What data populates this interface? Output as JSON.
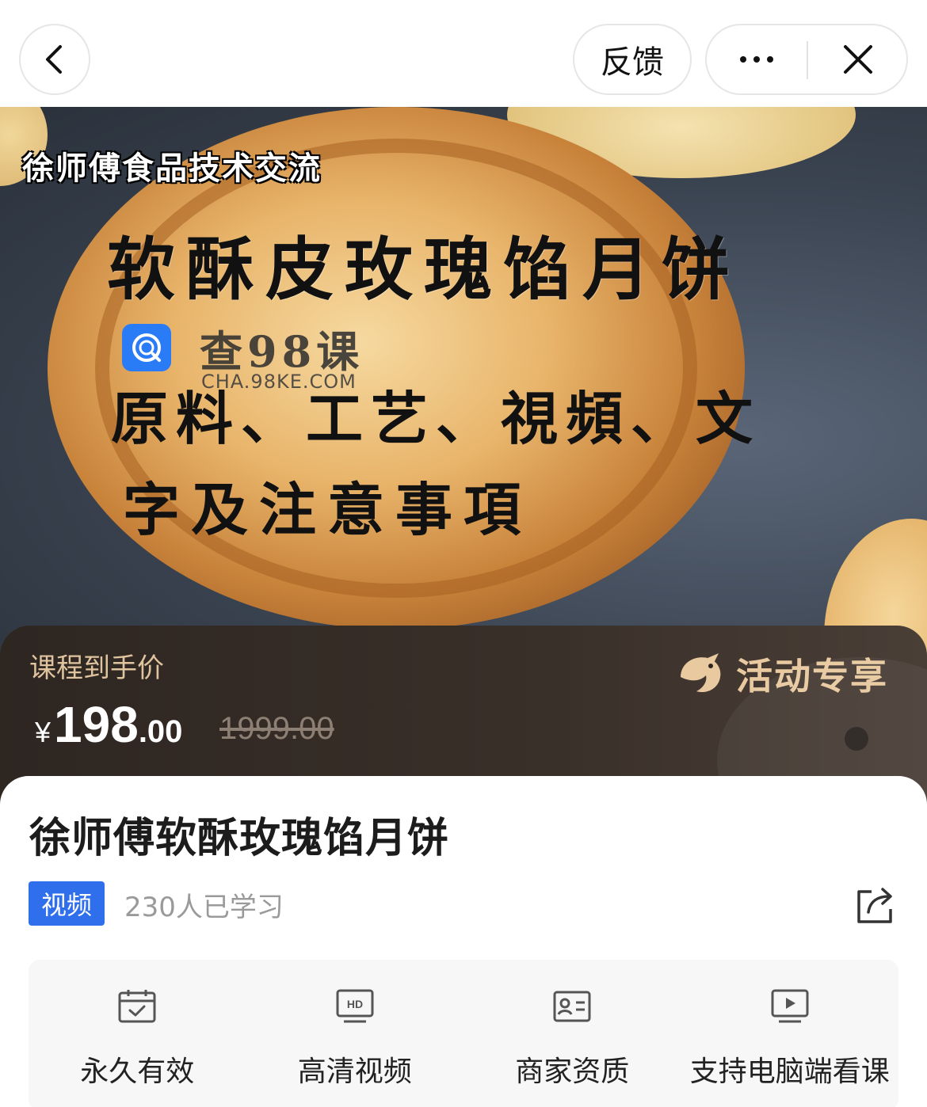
{
  "topbar": {
    "feedback_label": "反馈"
  },
  "hero": {
    "subtitle": "徐师傅食品技术交流",
    "headline": "软酥皮玫瑰馅月饼",
    "line2": "原料、工艺、視頻、文",
    "line3": "字及注意事項",
    "watermark_name": "查98课",
    "watermark_url": "CHA.98KE.COM"
  },
  "price": {
    "label": "课程到手价",
    "currency": "¥",
    "integer": "198",
    "decimal": ".00",
    "original": "1999.00",
    "promo_label": "活动专享"
  },
  "course": {
    "title": "徐师傅软酥玫瑰馅月饼",
    "tag": "视频",
    "learners": "230人已学习"
  },
  "features": [
    {
      "icon": "calendar-check-icon",
      "label": "永久有效"
    },
    {
      "icon": "hd-monitor-icon",
      "label": "高清视频"
    },
    {
      "icon": "id-card-icon",
      "label": "商家资质"
    },
    {
      "icon": "monitor-play-icon",
      "label": "支持电脑端看课"
    }
  ],
  "colors": {
    "accent_blue": "#2f6fec",
    "price_band_bg": "#2e2621",
    "price_label": "#e0c4a0",
    "promo_gold": "#e8c9a0"
  }
}
